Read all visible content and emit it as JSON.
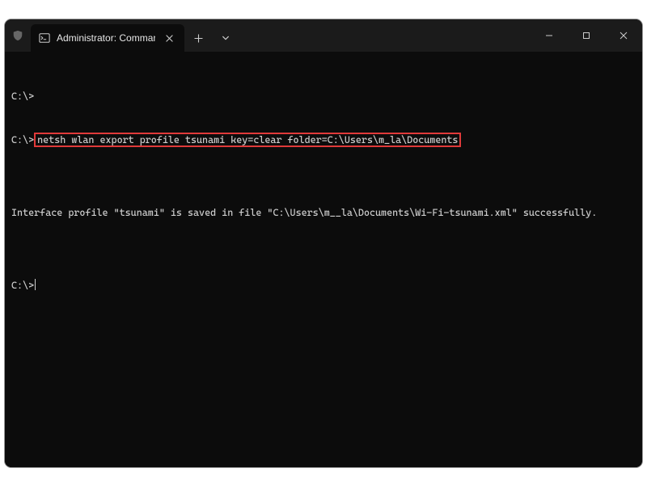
{
  "window": {
    "tab_title": "Administrator: Command Pro"
  },
  "terminal": {
    "line1_prompt": "C:\\>",
    "line2_prompt": "C:\\>",
    "line2_cmd": "netsh wlan export profile tsunami key=clear folder=C:\\Users\\m_la\\Documents",
    "blank1": "",
    "line3_output": "Interface profile \"tsunami\" is saved in file \"C:\\Users\\m__la\\Documents\\Wi-Fi-tsunami.xml\" successfully.",
    "blank2": "",
    "line4_prompt": "C:\\>"
  }
}
